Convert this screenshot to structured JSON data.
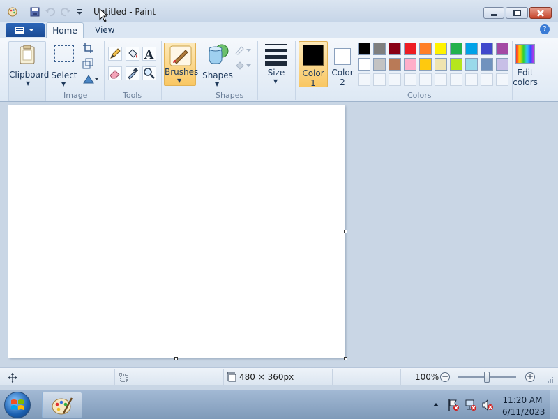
{
  "window": {
    "title": "Untitled - Paint"
  },
  "tabs": {
    "home": "Home",
    "view": "View"
  },
  "help": "?",
  "ribbon": {
    "clipboard": {
      "label": "Clipboard"
    },
    "image": {
      "select": "Select",
      "group": "Image"
    },
    "tools": {
      "group": "Tools"
    },
    "brushes": {
      "label": "Brushes"
    },
    "shapes": {
      "label": "Shapes",
      "group": "Shapes"
    },
    "size": {
      "label": "Size"
    },
    "color1": {
      "label_line1": "Color",
      "label_line2": "1",
      "value": "#000000"
    },
    "color2": {
      "label_line1": "Color",
      "label_line2": "2",
      "value": "#ffffff"
    },
    "colors": {
      "group": "Colors",
      "row1": [
        "#000000",
        "#7f7f7f",
        "#880015",
        "#ed1c24",
        "#ff7f27",
        "#fff200",
        "#22b14c",
        "#00a2e8",
        "#3f48cc",
        "#a349a4"
      ],
      "row2": [
        "#ffffff",
        "#c3c3c3",
        "#b97a57",
        "#ffaec9",
        "#ffc90e",
        "#efe4b0",
        "#b5e61d",
        "#99d9ea",
        "#7092be",
        "#c8bfe7"
      ]
    },
    "edit_colors": {
      "line1": "Edit",
      "line2": "colors"
    }
  },
  "status": {
    "image_size": "480 × 360px",
    "zoom": "100%"
  },
  "taskbar": {
    "time": "11:20 AM",
    "date": "6/11/2023"
  }
}
